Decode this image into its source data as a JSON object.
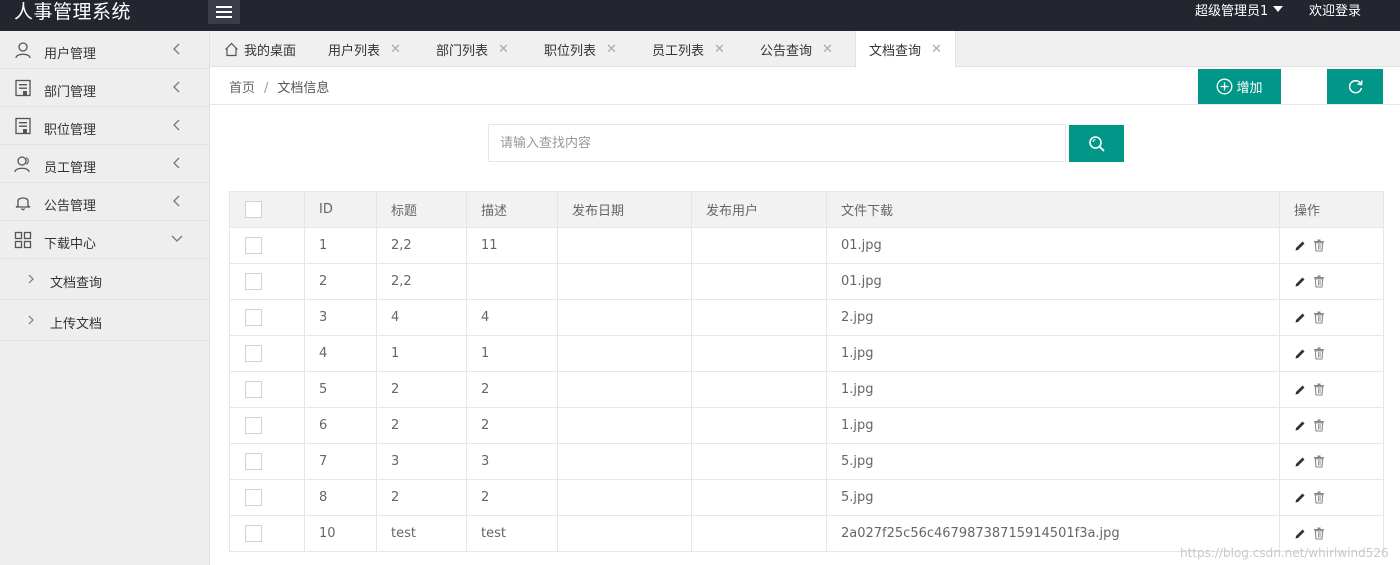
{
  "header": {
    "app_title": "人事管理系统",
    "user_name": "超级管理员1",
    "logout": "欢迎登录"
  },
  "sidebar": {
    "items": [
      {
        "label": "用户管理",
        "icon": "user-icon",
        "expanded": false
      },
      {
        "label": "部门管理",
        "icon": "building-icon",
        "expanded": false
      },
      {
        "label": "职位管理",
        "icon": "building-icon",
        "expanded": false
      },
      {
        "label": "员工管理",
        "icon": "users-icon",
        "expanded": false
      },
      {
        "label": "公告管理",
        "icon": "bell-icon",
        "expanded": false
      },
      {
        "label": "下载中心",
        "icon": "grid-icon",
        "expanded": true
      }
    ],
    "sub_items": [
      {
        "label": "文档查询"
      },
      {
        "label": "上传文档"
      }
    ]
  },
  "tabs": [
    {
      "label": "我的桌面",
      "closable": false,
      "active": false
    },
    {
      "label": "用户列表",
      "closable": true,
      "active": false
    },
    {
      "label": "部门列表",
      "closable": true,
      "active": false
    },
    {
      "label": "职位列表",
      "closable": true,
      "active": false
    },
    {
      "label": "员工列表",
      "closable": true,
      "active": false
    },
    {
      "label": "公告查询",
      "closable": true,
      "active": false
    },
    {
      "label": "文档查询",
      "closable": true,
      "active": true
    }
  ],
  "breadcrumb": {
    "home": "首页",
    "separator": "/",
    "current": "文档信息"
  },
  "actions": {
    "add_label": "增加"
  },
  "search": {
    "placeholder": "请输入查找内容",
    "value": ""
  },
  "table": {
    "columns": [
      "ID",
      "标题",
      "描述",
      "发布日期",
      "发布用户",
      "文件下载",
      "操作"
    ],
    "rows": [
      {
        "id": "1",
        "title": "2,2",
        "desc": "11",
        "date": "",
        "user": "",
        "file": "01.jpg"
      },
      {
        "id": "2",
        "title": "2,2",
        "desc": "",
        "date": "",
        "user": "",
        "file": "01.jpg"
      },
      {
        "id": "3",
        "title": "4",
        "desc": "4",
        "date": "",
        "user": "",
        "file": "2.jpg"
      },
      {
        "id": "4",
        "title": "1",
        "desc": "1",
        "date": "",
        "user": "",
        "file": "1.jpg"
      },
      {
        "id": "5",
        "title": "2",
        "desc": "2",
        "date": "",
        "user": "",
        "file": "1.jpg"
      },
      {
        "id": "6",
        "title": "2",
        "desc": "2",
        "date": "",
        "user": "",
        "file": "1.jpg"
      },
      {
        "id": "7",
        "title": "3",
        "desc": "3",
        "date": "",
        "user": "",
        "file": "5.jpg"
      },
      {
        "id": "8",
        "title": "2",
        "desc": "2",
        "date": "",
        "user": "",
        "file": "5.jpg"
      },
      {
        "id": "10",
        "title": "test",
        "desc": "test",
        "date": "",
        "user": "",
        "file": "2a027f25c56c46798738715914501f3a.jpg"
      }
    ]
  },
  "watermark": "https://blog.csdn.net/whirlwind526",
  "colors": {
    "accent": "#009688",
    "topbar": "#23262e",
    "sidebar": "#eeeeee"
  }
}
